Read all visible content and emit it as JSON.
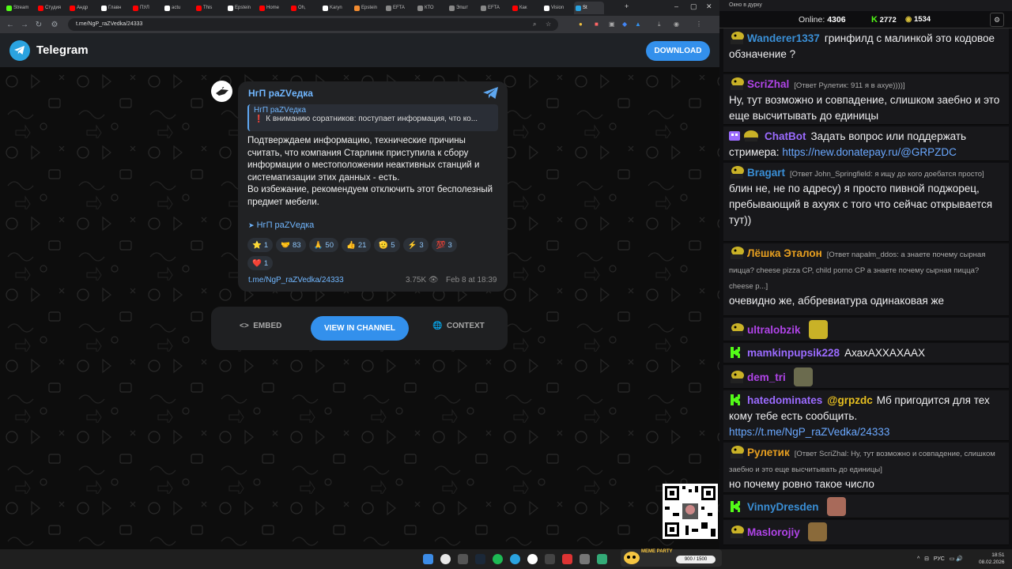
{
  "browser": {
    "tabs": [
      {
        "label": "Stream",
        "color": "#53fc18"
      },
      {
        "label": "Студия",
        "color": "#ff0000"
      },
      {
        "label": "Андр",
        "color": "#ff0000"
      },
      {
        "label": "Главн",
        "color": "#ffffff"
      },
      {
        "label": "ПУЛ",
        "color": "#ff0000"
      },
      {
        "label": "actu",
        "color": "#ffffff"
      },
      {
        "label": "This",
        "color": "#ff0000"
      },
      {
        "label": "Epstein",
        "color": "#ffffff"
      },
      {
        "label": "Home",
        "color": "#ff0000"
      },
      {
        "label": "Oh,",
        "color": "#ff0000"
      },
      {
        "label": "Karyn",
        "color": "#ffffff"
      },
      {
        "label": "Epstein",
        "color": "#f28b30"
      },
      {
        "label": "EFTA",
        "color": "#888888"
      },
      {
        "label": "КТО",
        "color": "#888888"
      },
      {
        "label": "Эпшт",
        "color": "#888888"
      },
      {
        "label": "EFTA",
        "color": "#888888"
      },
      {
        "label": "Как",
        "color": "#ff0000"
      },
      {
        "label": "Vision",
        "color": "#ffffff"
      },
      {
        "label": "St",
        "color": "#2aa3e0"
      }
    ],
    "url": "t.me/NgP_raZVedka/24333"
  },
  "telegram": {
    "brand": "Telegram",
    "download": "DOWNLOAD",
    "post": {
      "channel": "НгП раZVедка",
      "reply_channel": "НгП раZVедка",
      "reply_text": "❗ К вниманию соратников: поступает информация, что ко...",
      "text": "Подтверждаем информацию, технические причины считать, что компания Старлинк приступила к сбору информации о местоположении неактивных станций и систематизации этих данных - есть.\nВо избежание, рекомендуем отключить этот бесполезный предмет мебели.",
      "signature": "НгП раZVедка",
      "reactions": [
        {
          "emoji": "⭐",
          "count": "1"
        },
        {
          "emoji": "🤝",
          "count": "83"
        },
        {
          "emoji": "🙏",
          "count": "50"
        },
        {
          "emoji": "👍",
          "count": "21"
        },
        {
          "emoji": "🫡",
          "count": "5"
        },
        {
          "emoji": "⚡",
          "count": "3"
        },
        {
          "emoji": "💯",
          "count": "3"
        }
      ],
      "reactions_row2": [
        {
          "emoji": "❤️",
          "count": "1"
        }
      ],
      "link": "t.me/NgP_raZVedka/24333",
      "views": "3.75K",
      "date": "Feb 8 at 18:39"
    },
    "actions": {
      "embed": "EMBED",
      "view": "VIEW IN CHANNEL",
      "context": "CONTEXT"
    }
  },
  "overlay": {
    "meme_party_title": "MEME PARTY",
    "meme_party_count": "900 / 1500"
  },
  "chat": {
    "title": "Окно в дурку",
    "online_label": "Online:",
    "online": "4306",
    "kick_viewers": "2772",
    "twitch_viewers": "1534",
    "messages": [
      {
        "user": "Wanderer1337",
        "color": "#3a8fd6",
        "badge": "yellow",
        "reply": "",
        "text": "гринфилд с малинкой это кодовое обзначение ?"
      },
      {
        "user": "ScriZhal",
        "color": "#b044e8",
        "badge": "yellow",
        "reply": "[Ответ Рулетик: 911 я в ахуе))))]",
        "text": "Ну, тут возможно и совпадение, слишком заебно и это еще высчитывать до единицы"
      },
      {
        "user": "ChatBot",
        "color": "#9b6bff",
        "badge": "bot",
        "reply": "",
        "text": "Задать вопрос или поддержать стримера:",
        "link": "https://new.donatepay.ru/@GRPZDC"
      },
      {
        "user": "Bragart",
        "color": "#3a8fd6",
        "badge": "yellow",
        "reply": "[Ответ John_Springfield: я ищу до кого доебатся просто]",
        "text": "блин не, не по адресу) я просто пивной поджорец, пребывающий в ахуях с того что сейчас открывается тут))"
      },
      {
        "user": "Лёшка Эталон",
        "color": "#e8a020",
        "badge": "yellow",
        "reply": "[Ответ napalm_ddos: а знаете почему сырная пицца? cheese pizza CP, child porno CP а знаете почему сырная пицца? cheese p...]",
        "text": "очевидно же, аббревиатура одинаковая же"
      },
      {
        "user": "ultralobzik",
        "color": "#b044e8",
        "badge": "yellow",
        "reply": "",
        "text": "",
        "emote": true
      },
      {
        "user": "mamkinpupsik228",
        "color": "#9b6bff",
        "badge": "kick",
        "reply": "",
        "text": "АхахАХХАХААХ"
      },
      {
        "user": "dem_tri",
        "color": "#b044e8",
        "badge": "yellow",
        "reply": "",
        "text": "",
        "emote": true
      },
      {
        "user": "hatedominates",
        "color": "#9b6bff",
        "badge": "kick",
        "reply": "",
        "mention": "@grpzdc",
        "text": "Мб пригодится для тех кому тебе есть сообщить.",
        "link": "https://t.me/NgP_raZVedka/24333"
      },
      {
        "user": "Рулетик",
        "color": "#e8a020",
        "badge": "yellow",
        "reply": "[Ответ ScriZhal: Ну, тут возможно и совпадение, слишком заебно и это еще высчитывать до единицы]",
        "text": "но почему ровно такое число"
      },
      {
        "user": "VinnyDresden",
        "color": "#3a8fd6",
        "badge": "kick",
        "reply": "",
        "text": "",
        "emote": true
      },
      {
        "user": "Maslorojiy",
        "color": "#b044e8",
        "badge": "yellow",
        "reply": "",
        "text": "",
        "emote": true
      }
    ]
  },
  "taskbar": {
    "lang": "РУС",
    "time": "18:51",
    "date": "08.02.2026"
  }
}
